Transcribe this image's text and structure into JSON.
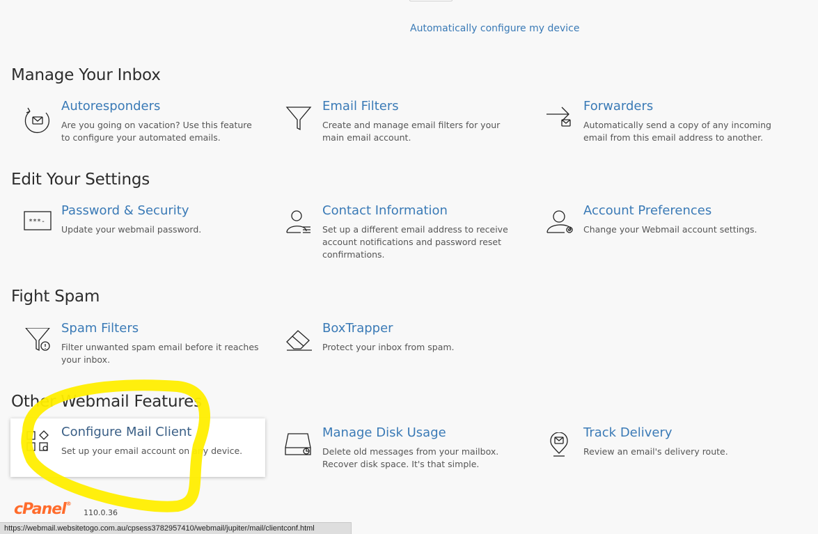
{
  "top": {
    "auto_configure_link": "Automatically configure my device"
  },
  "sections": {
    "manage_inbox": {
      "title": "Manage Your Inbox",
      "cards": {
        "autoresponders": {
          "title": "Autoresponders",
          "desc": "Are you going on vacation? Use this feature to configure your automated emails.",
          "icon": "autoresponder-icon"
        },
        "email_filters": {
          "title": "Email Filters",
          "desc": "Create and manage email filters for your main email account.",
          "icon": "filter-icon"
        },
        "forwarders": {
          "title": "Forwarders",
          "desc": "Automatically send a copy of any incoming email from this email address to another.",
          "icon": "forward-icon"
        }
      }
    },
    "edit_settings": {
      "title": "Edit Your Settings",
      "cards": {
        "password_security": {
          "title": "Password & Security",
          "desc": "Update your webmail password.",
          "icon": "password-icon"
        },
        "contact_information": {
          "title": "Contact Information",
          "desc": "Set up a different email address to receive account notifications and password reset confirmations.",
          "icon": "contact-icon"
        },
        "account_preferences": {
          "title": "Account Preferences",
          "desc": "Change your Webmail account settings.",
          "icon": "user-settings-icon"
        }
      }
    },
    "fight_spam": {
      "title": "Fight Spam",
      "cards": {
        "spam_filters": {
          "title": "Spam Filters",
          "desc": "Filter unwanted spam email before it reaches your inbox.",
          "icon": "spam-filter-icon"
        },
        "boxtrapper": {
          "title": "BoxTrapper",
          "desc": "Protect your inbox from spam.",
          "icon": "eraser-icon"
        }
      }
    },
    "other_features": {
      "title": "Other Webmail Features",
      "cards": {
        "configure_mail_client": {
          "title": "Configure Mail Client",
          "desc": "Set up your email account on any device.",
          "icon": "apps-icon"
        },
        "manage_disk_usage": {
          "title": "Manage Disk Usage",
          "desc": "Delete old messages from your mailbox. Recover disk space. It's that simple.",
          "icon": "disk-icon"
        },
        "track_delivery": {
          "title": "Track Delivery",
          "desc": "Review an email's delivery route.",
          "icon": "location-pin-icon"
        }
      }
    }
  },
  "footer": {
    "logo": "cPanel",
    "version": "110.0.36"
  },
  "status_bar": {
    "url": "https://webmail.websitetogo.com.au/cpsess3782957410/webmail/jupiter/mail/clientconf.html"
  },
  "colors": {
    "link": "#3a7ab6",
    "highlight": "#ffee00",
    "brand": "#ff6c2c"
  }
}
